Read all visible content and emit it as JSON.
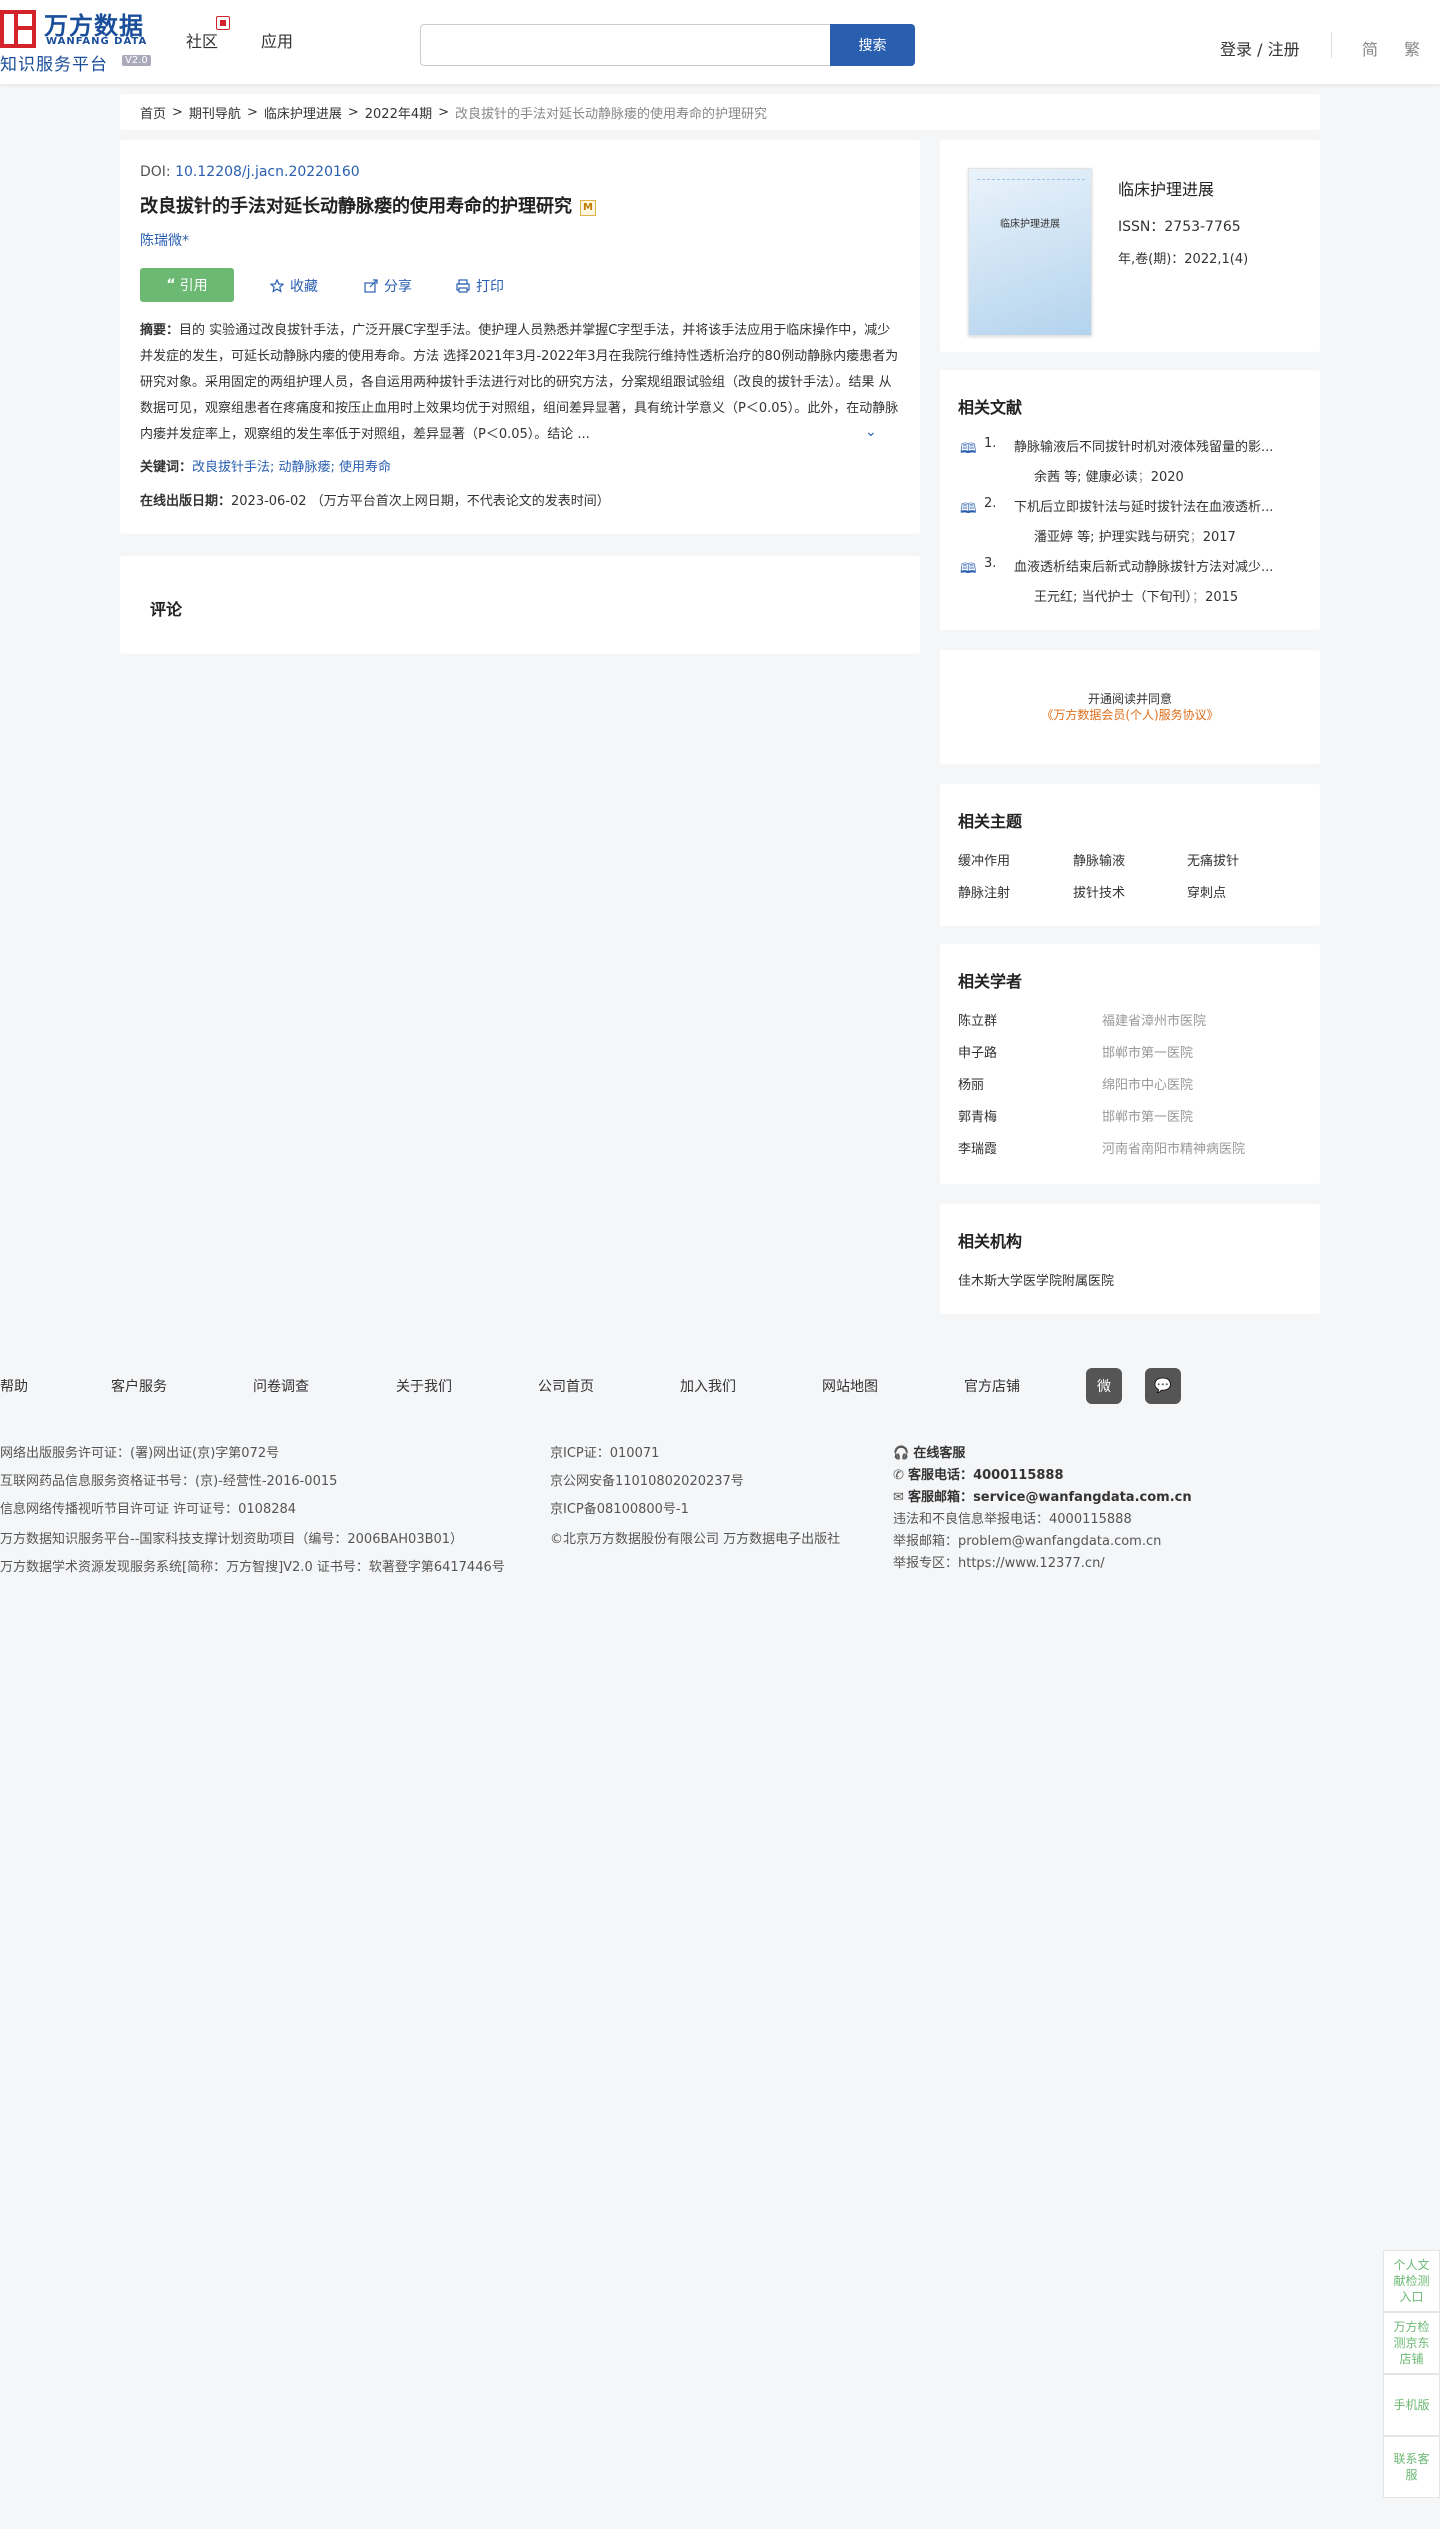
{
  "header": {
    "logo_cn": "万方数据",
    "logo_en": "WANFANG DATA",
    "logo_sub": "知识服务平台",
    "logo_ver": "V2.0",
    "nav": [
      "社区",
      "应用"
    ],
    "search_placeholder": "",
    "search_btn": "搜索",
    "login": "登录 / 注册",
    "lang": [
      "简",
      "繁"
    ]
  },
  "breadcrumb": [
    "首页",
    "期刊导航",
    "临床护理进展",
    "2022年4期",
    "改良拔针的手法对延长动静脉瘘的使用寿命的护理研究"
  ],
  "article": {
    "doi_label": "DOI: ",
    "doi": "10.12208/j.jacn.20220160",
    "title": "改良拔针的手法对延长动静脉瘘的使用寿命的护理研究",
    "m_badge": "M",
    "author": "陈瑞微*",
    "cite": "引用",
    "actions": [
      "收藏",
      "分享",
      "打印"
    ],
    "abstract_label": "摘要：",
    "abstract": "目的 实验通过改良拔针手法，广泛开展C字型手法。使护理人员熟悉并掌握C字型手法，并将该手法应用于临床操作中，减少并发症的发生，可延长动静脉内瘘的使用寿命。方法 选择2021年3月-2022年3月在我院行维持性透析治疗的80例动静脉内瘘患者为研究对象。采用固定的两组护理人员，各自运用两种拔针手法进行对比的研究方法，分案规组跟试验组（改良的拔针手法）。结果 从数据可见，观察组患者在疼痛度和按压止血用时上效果均优于对照组，组间差异显著，具有统计学意义（P＜0.05）。此外，在动静脉内瘘并发症率上，观察组的发生率低于对照组，差异显著（P＜0.05）。结论 ...",
    "kw_label": "关键词：",
    "keywords": "改良拔针手法; 动静脉瘘; 使用寿命",
    "date_label": "在线出版日期：",
    "date": "2023-06-02 （万方平台首次上网日期，不代表论文的发表时间）"
  },
  "comment": {
    "title": "评论"
  },
  "journal": {
    "cover_title": "临床护理进展",
    "title": "临床护理进展",
    "issn": "ISSN：2753-7765",
    "vol": "年,卷(期)：2022,1(4)"
  },
  "related_docs": {
    "title": "相关文献",
    "items": [
      {
        "num": "1.",
        "title": "静脉输液后不同拔针时机对液体残留量的影...",
        "authors": "余茜  等;",
        "source": "健康必读",
        "year": "2020"
      },
      {
        "num": "2.",
        "title": "下机后立即拔针法与延时拔针法在血液透析...",
        "authors": "潘亚婷  等;",
        "source": "护理实践与研究",
        "year": "2017"
      },
      {
        "num": "3.",
        "title": "血液透析结束后新式动静脉拔针方法对减少...",
        "authors": "王元红;",
        "source": "当代护士（下旬刊）",
        "year": "2015"
      }
    ]
  },
  "agreement": {
    "line1": "开通阅读并同意",
    "line2": "《万方数据会员(个人)服务协议》"
  },
  "topics": {
    "title": "相关主题",
    "items": [
      "缓冲作用",
      "静脉输液",
      "无痛拔针",
      "静脉注射",
      "拔针技术",
      "穿刺点"
    ]
  },
  "scholars": {
    "title": "相关学者",
    "items": [
      {
        "name": "陈立群",
        "org": "福建省漳州市医院"
      },
      {
        "name": "申子路",
        "org": "邯郸市第一医院"
      },
      {
        "name": "杨丽",
        "org": "绵阳市中心医院"
      },
      {
        "name": "郭青梅",
        "org": "邯郸市第一医院"
      },
      {
        "name": "李瑞霞",
        "org": "河南省南阳市精神病医院"
      }
    ]
  },
  "institutions": {
    "title": "相关机构",
    "items": [
      "佳木斯大学医学院附属医院"
    ]
  },
  "footer": {
    "links": [
      "帮助",
      "客户服务",
      "问卷调查",
      "关于我们",
      "公司首页",
      "加入我们",
      "网站地图",
      "官方店铺"
    ],
    "social": [
      "weibo-icon",
      "wechat-icon"
    ],
    "col1": [
      "网络出版服务许可证：(署)网出证(京)字第072号",
      "互联网药品信息服务资格证书号：(京)-经营性-2016-0015",
      "信息网络传播视听节目许可证 许可证号：0108284",
      "万方数据知识服务平台--国家科技支撑计划资助项目（编号：2006BAH03B01）",
      "万方数据学术资源发现服务系统[简称：万方智搜]V2.0 证书号：软著登字第6417446号"
    ],
    "col2": [
      "京ICP证：010071",
      "京公网安备11010802020237号",
      "京ICP备08100800号-1",
      "©北京万方数据股份有限公司 万方数据电子出版社"
    ],
    "col3": {
      "online": "在线客服",
      "phone_label": "客服电话：",
      "phone": "4000115888",
      "email_label": "客服邮箱：",
      "email": "service@wanfangdata.com.cn",
      "report_phone": "违法和不良信息举报电话：4000115888",
      "report_email": "举报邮箱：problem@wanfangdata.com.cn",
      "report_zone": "举报专区：https://www.12377.cn/"
    }
  },
  "floats": [
    "个人文献检测入口",
    "万方检测京东店铺",
    "手机版",
    "联系客服"
  ]
}
